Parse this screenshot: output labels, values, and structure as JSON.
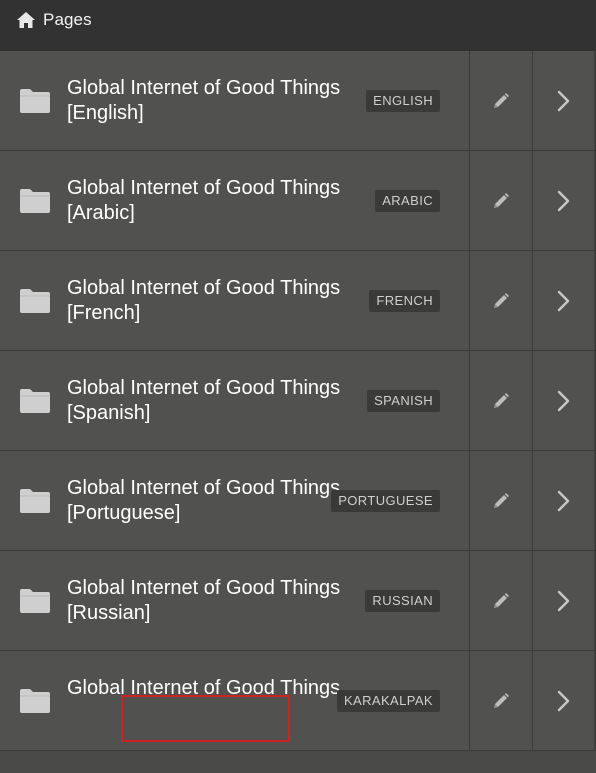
{
  "header": {
    "title": "Pages",
    "icon": "home-icon"
  },
  "pages": [
    {
      "name": "Global Internet of Good Things [English]",
      "language": "ENGLISH"
    },
    {
      "name": "Global Internet of Good Things [Arabic]",
      "language": "ARABIC"
    },
    {
      "name": "Global Internet of Good Things [French]",
      "language": "FRENCH"
    },
    {
      "name": "Global Internet of Good Things [Spanish]",
      "language": "SPANISH"
    },
    {
      "name": "Global Internet of Good Things [Portuguese]",
      "language": "PORTUGUESE"
    },
    {
      "name": "Global Internet of Good Things [Russian]",
      "language": "RUSSIAN"
    },
    {
      "name": "Global Internet of Good Things",
      "language": "KARAKALPAK"
    }
  ],
  "icons": {
    "row_icon": "folder-icon",
    "edit": "pencil-icon",
    "open": "chevron-right-icon"
  },
  "colors": {
    "header_bg": "#323232",
    "row_bg": "#51524f",
    "badge_bg": "#3a3a39",
    "highlight": "#cc2222"
  }
}
